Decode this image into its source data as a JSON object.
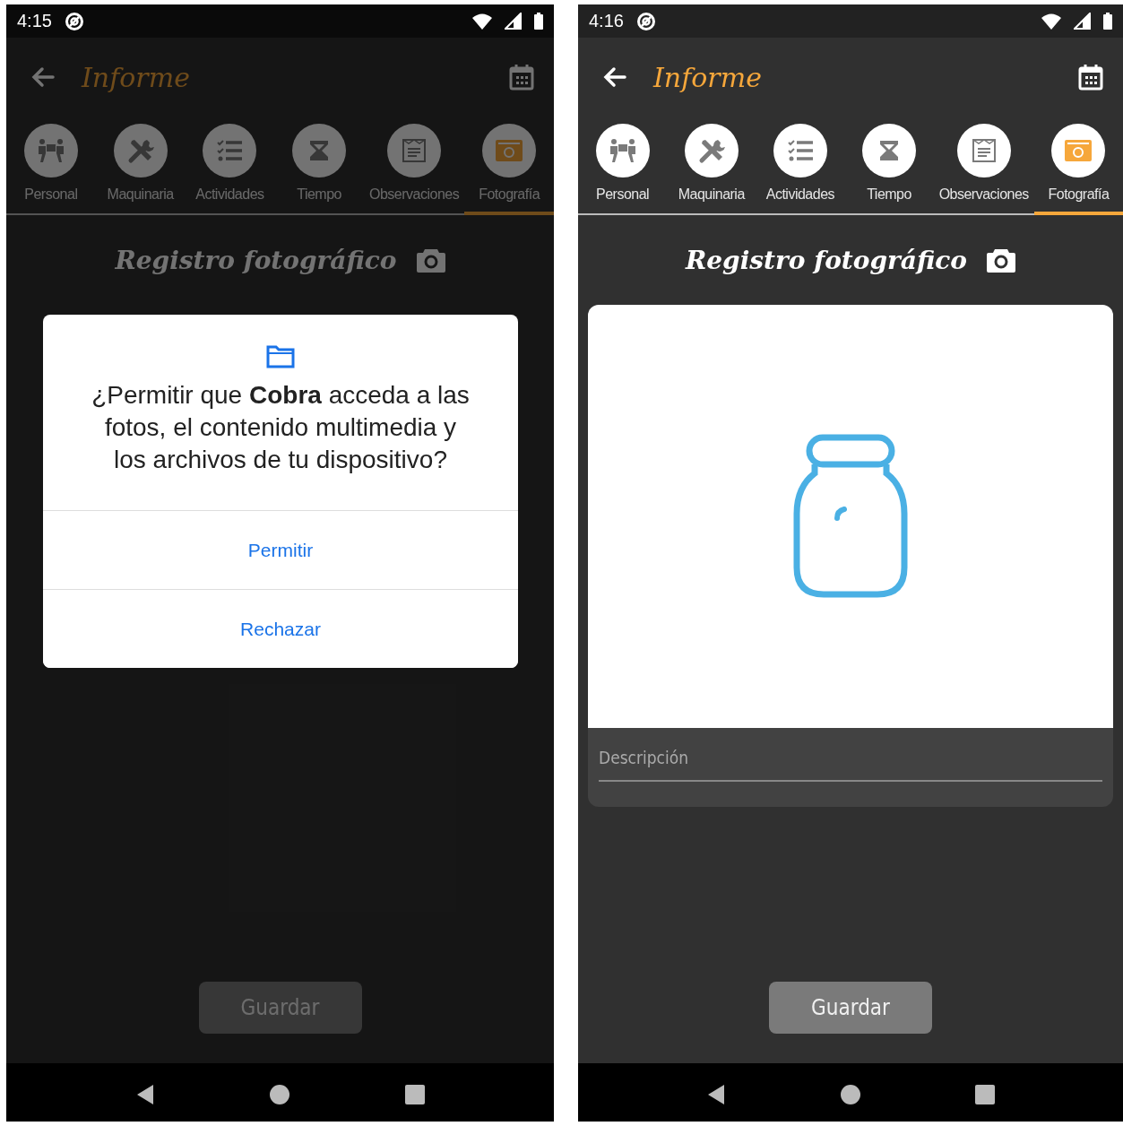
{
  "screens": [
    {
      "dimmed": true,
      "status_bar": {
        "time": "4:15"
      },
      "app_bar": {
        "title": "Informe"
      },
      "tabs": [
        {
          "label": "Personal",
          "selected": false
        },
        {
          "label": "Maquinaria",
          "selected": false
        },
        {
          "label": "Actividades",
          "selected": false
        },
        {
          "label": "Tiempo",
          "selected": false
        },
        {
          "label": "Observaciones",
          "selected": false
        },
        {
          "label": "Fotografía",
          "selected": true
        }
      ],
      "section_title": "Registro fotográfico",
      "dialog": {
        "message": "¿Permitir que **Cobra** acceda a las fotos, el contenido multimedia y los archivos de tu dispositivo?",
        "buttons": [
          {
            "label": "Permitir"
          },
          {
            "label": "Rechazar"
          }
        ]
      },
      "save_button": {
        "label": "Guardar",
        "disabled": true
      }
    },
    {
      "dimmed": false,
      "status_bar": {
        "time": "4:16"
      },
      "app_bar": {
        "title": "Informe"
      },
      "tabs": [
        {
          "label": "Personal",
          "selected": false
        },
        {
          "label": "Maquinaria",
          "selected": false
        },
        {
          "label": "Actividades",
          "selected": false
        },
        {
          "label": "Tiempo",
          "selected": false
        },
        {
          "label": "Observaciones",
          "selected": false
        },
        {
          "label": "Fotografía",
          "selected": true
        }
      ],
      "section_title": "Registro fotográfico",
      "photo_card": {
        "placeholder": "Descripción"
      },
      "save_button": {
        "label": "Guardar",
        "disabled": true
      }
    }
  ]
}
